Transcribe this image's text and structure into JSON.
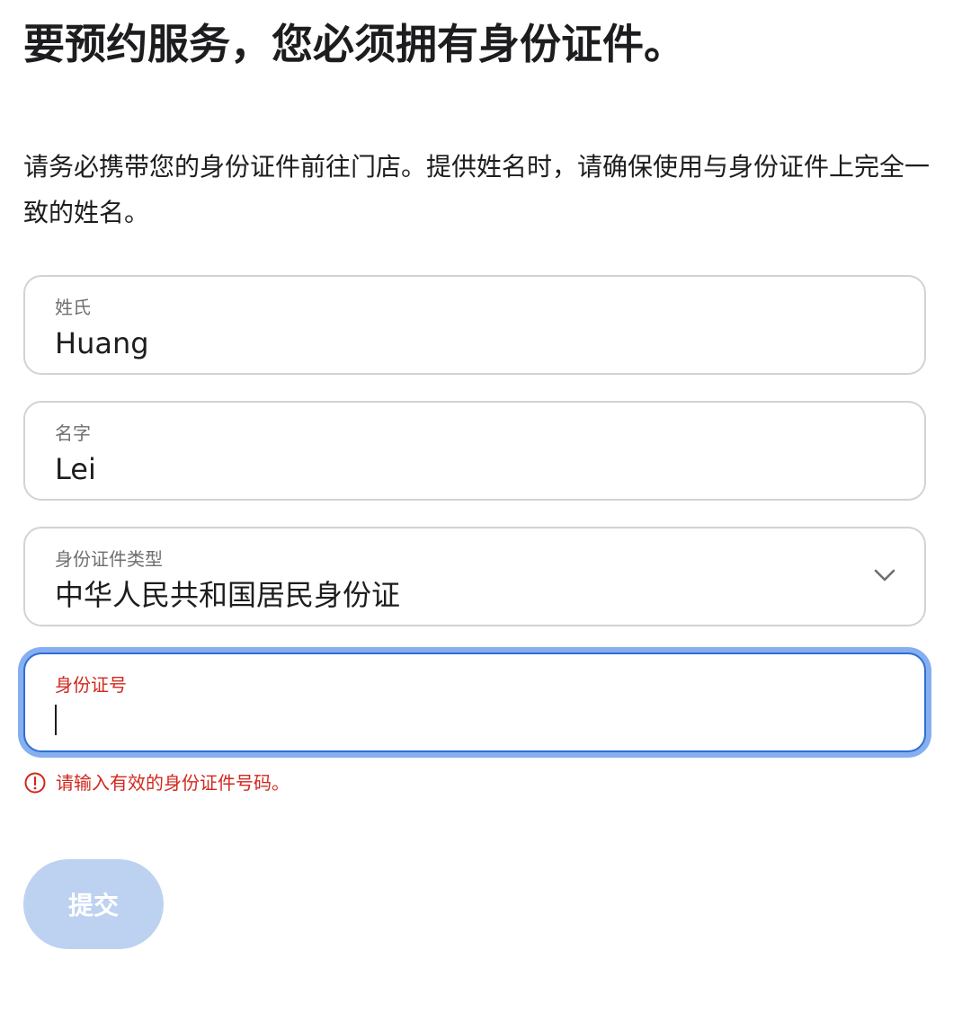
{
  "header": {
    "title": "要预约服务，您必须拥有身份证件。"
  },
  "intro": {
    "text": "请务必携带您的身份证件前往门店。提供姓名时，请确保使用与身份证件上完全一致的姓名。"
  },
  "form": {
    "surname": {
      "label": "姓氏",
      "value": "Huang"
    },
    "given_name": {
      "label": "名字",
      "value": "Lei"
    },
    "id_type": {
      "label": "身份证件类型",
      "value": "中华人民共和国居民身份证",
      "icon": "chevron-down-icon"
    },
    "id_number": {
      "label": "身份证号",
      "value": "",
      "state": "focused-error",
      "error": "请输入有效的身份证件号码。",
      "error_icon": "alert-circle-icon"
    },
    "submit": {
      "label": "提交",
      "enabled": false
    }
  },
  "colors": {
    "text": "#1d1d1f",
    "label": "#6e6e73",
    "border": "#d2d2d7",
    "focus": "#2f6fd6",
    "focus_ring": "#86aff0",
    "error": "#d2281e",
    "submit_disabled": "#bdd1f1"
  }
}
